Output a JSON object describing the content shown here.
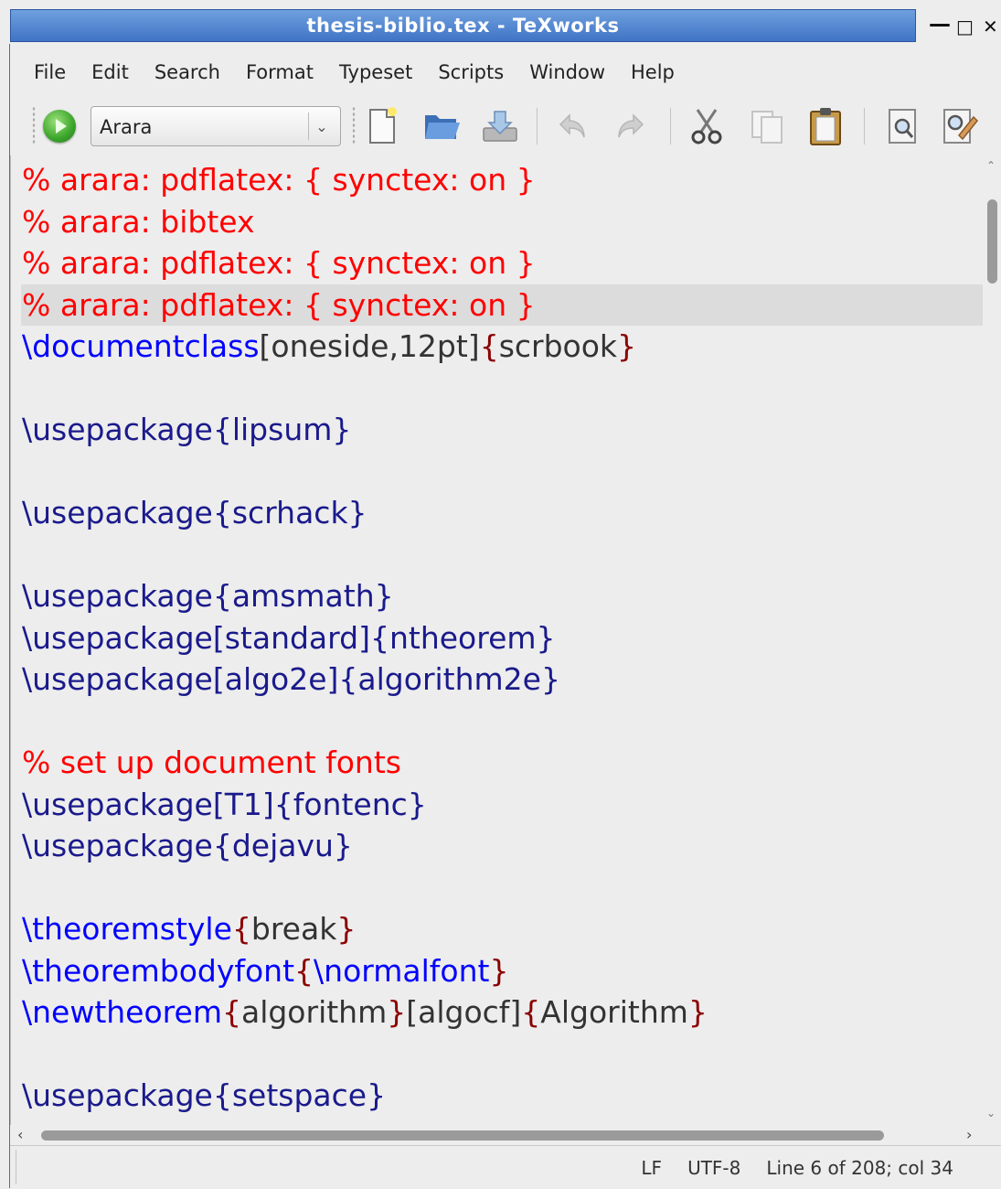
{
  "window": {
    "title": "thesis-biblio.tex - TeXworks",
    "minimize_glyph": "—",
    "maximize_glyph": "□",
    "close_glyph": "✕"
  },
  "menu": {
    "items": [
      "File",
      "Edit",
      "Search",
      "Format",
      "Typeset",
      "Scripts",
      "Window",
      "Help"
    ]
  },
  "toolbar": {
    "engine_selected": "Arara",
    "icons": [
      "typeset-run-icon",
      "new-file-icon",
      "open-folder-icon",
      "save-icon",
      "undo-icon",
      "redo-icon",
      "cut-icon",
      "copy-icon",
      "paste-icon",
      "search-icon",
      "replace-icon"
    ]
  },
  "editor": {
    "current_line_index": 3,
    "lines": [
      [
        [
          "comment",
          "% arara: pdflatex: { synctex: on }"
        ]
      ],
      [
        [
          "comment",
          "% arara: bibtex"
        ]
      ],
      [
        [
          "comment",
          "% arara: pdflatex: { synctex: on }"
        ]
      ],
      [
        [
          "comment",
          "% arara: pdflatex: { synctex: on }"
        ]
      ],
      [
        [
          "cmd",
          "\\documentclass"
        ],
        [
          "opt",
          "[oneside,12pt]"
        ],
        [
          "brace",
          "{"
        ],
        [
          "arg",
          "scrbook"
        ],
        [
          "brace",
          "}"
        ]
      ],
      [],
      [
        [
          "pkg",
          "\\usepackage{lipsum}"
        ]
      ],
      [],
      [
        [
          "pkg",
          "\\usepackage{scrhack}"
        ]
      ],
      [],
      [
        [
          "pkg",
          "\\usepackage{amsmath}"
        ]
      ],
      [
        [
          "pkg",
          "\\usepackage[standard]{ntheorem}"
        ]
      ],
      [
        [
          "pkg",
          "\\usepackage[algo2e]{algorithm2e}"
        ]
      ],
      [],
      [
        [
          "comment",
          "% set up document fonts"
        ]
      ],
      [
        [
          "pkg",
          "\\usepackage[T1]{fontenc}"
        ]
      ],
      [
        [
          "pkg",
          "\\usepackage{dejavu}"
        ]
      ],
      [],
      [
        [
          "cmd",
          "\\theoremstyle"
        ],
        [
          "brace",
          "{"
        ],
        [
          "arg",
          "break"
        ],
        [
          "brace",
          "}"
        ]
      ],
      [
        [
          "cmd",
          "\\theorembodyfont"
        ],
        [
          "brace",
          "{"
        ],
        [
          "cmd",
          "\\normalfont"
        ],
        [
          "brace",
          "}"
        ]
      ],
      [
        [
          "cmd",
          "\\newtheorem"
        ],
        [
          "brace",
          "{"
        ],
        [
          "arg",
          "algorithm"
        ],
        [
          "brace",
          "}"
        ],
        [
          "opt",
          "[algocf]"
        ],
        [
          "brace",
          "{"
        ],
        [
          "arg",
          "Algorithm"
        ],
        [
          "brace",
          "}"
        ]
      ],
      [],
      [
        [
          "pkg",
          "\\usepackage{setspace}"
        ]
      ]
    ]
  },
  "status": {
    "line_ending": "LF",
    "encoding": "UTF-8",
    "position": "Line 6 of 208; col 34"
  },
  "colors": {
    "comment": "#ff0000",
    "command": "#0000ff",
    "brace": "#8b0000",
    "package_text": "#1a1a8c",
    "title_bar": "#4f83d1"
  }
}
